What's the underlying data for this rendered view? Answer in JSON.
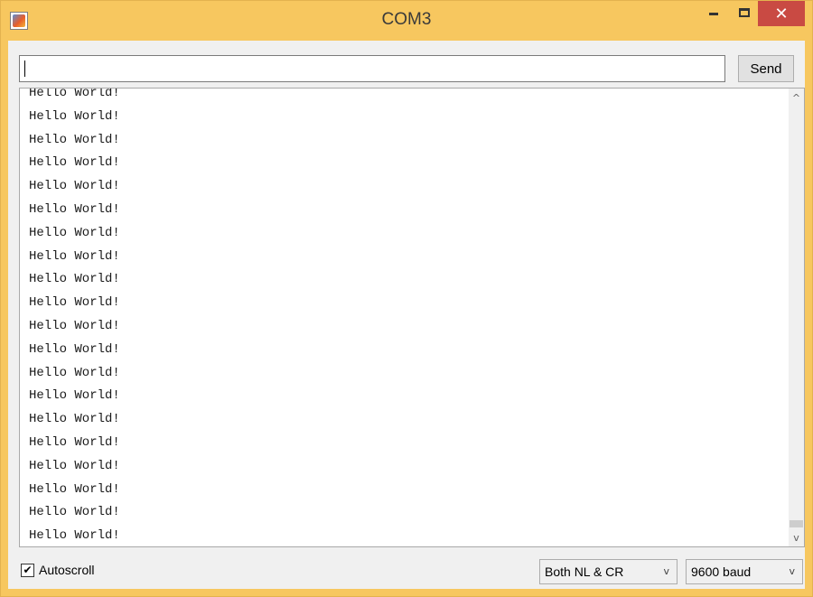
{
  "window": {
    "title": "COM3",
    "min_symbol": "",
    "close_symbol": "✕"
  },
  "send_area": {
    "input_value": "",
    "send_label": "Send"
  },
  "output": {
    "lines": [
      "Hello World!",
      "Hello World!",
      "Hello World!",
      "Hello World!",
      "Hello World!",
      "Hello World!",
      "Hello World!",
      "Hello World!",
      "Hello World!",
      "Hello World!",
      "Hello World!",
      "Hello World!",
      "Hello World!",
      "Hello World!",
      "Hello World!",
      "Hello World!",
      "Hello World!",
      "Hello World!",
      "Hello World!",
      "Hello World!"
    ]
  },
  "scrollbar": {
    "up_symbol": "^",
    "down_symbol": "v"
  },
  "footer": {
    "autoscroll_label": "Autoscroll",
    "autoscroll_checked": true,
    "check_symbol": "✔",
    "line_ending": "Both NL & CR",
    "baud_rate": "9600 baud",
    "dropdown_arrow": "v"
  },
  "icons": {
    "app": "java-cup-icon",
    "minimize": "minimize-icon",
    "maximize": "maximize-icon",
    "close": "close-icon"
  },
  "colors": {
    "title_bar": "#f7c75f",
    "close_button": "#c94a43",
    "client_bg": "#f0f0f0"
  }
}
